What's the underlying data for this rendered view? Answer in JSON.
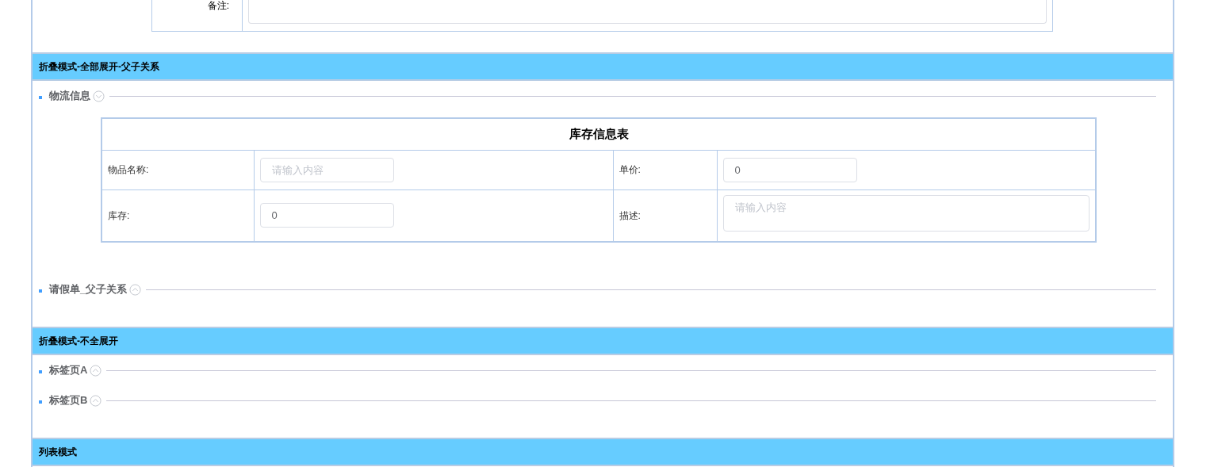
{
  "top_form": {
    "label": "备注:"
  },
  "sections": [
    {
      "title": "折叠模式-全部展开-父子关系",
      "groups": [
        {
          "title": "物流信息",
          "expanded": true,
          "table": {
            "title": "库存信息表",
            "rows": [
              [
                {
                  "label": "物品名称:",
                  "kind": "input",
                  "placeholder": "请输入内容"
                },
                {
                  "label": "单价:",
                  "kind": "input",
                  "value": "0"
                }
              ],
              [
                {
                  "label": "库存:",
                  "kind": "input",
                  "value": "0"
                },
                {
                  "label": "描述:",
                  "kind": "textarea",
                  "placeholder": "请输入内容"
                }
              ]
            ]
          }
        },
        {
          "title": "请假单_父子关系",
          "expanded": false
        }
      ]
    },
    {
      "title": "折叠模式-不全展开",
      "groups": [
        {
          "title": "标签页A",
          "expanded": false
        },
        {
          "title": "标签页B",
          "expanded": false
        }
      ]
    },
    {
      "title": "列表模式"
    }
  ]
}
